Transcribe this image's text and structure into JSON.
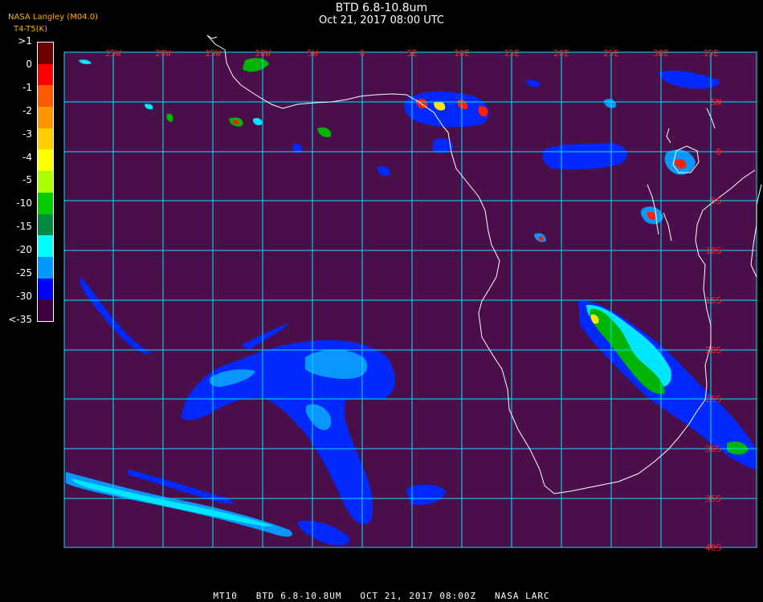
{
  "header": {
    "title": "BTD 6.8-10.8um",
    "subtitle": "Oct 21, 2017 08:00 UTC",
    "source_line1": "NASA Langley (M04.0)",
    "source_line2": "T4-T5(K)"
  },
  "legend": {
    "labels": [
      ">1",
      "0",
      "-1",
      "-2",
      "-3",
      "-4",
      "-5",
      "-10",
      "-15",
      "-20",
      "-25",
      "-30",
      "<-35"
    ],
    "colors": [
      "#6e0000",
      "#ff0000",
      "#ff5a00",
      "#ff9600",
      "#ffcd00",
      "#ffff00",
      "#aaff00",
      "#00cc00",
      "#008a40",
      "#00ffff",
      "#0096ff",
      "#0000ff",
      "#3c003c"
    ]
  },
  "map": {
    "background": "#4a0f4a",
    "grid_color": "#00e5ff",
    "coast_color": "#ffffff",
    "label_color": "#ff2020",
    "lon_labels": [
      "25W",
      "20W",
      "15W",
      "10W",
      "5W",
      "0",
      "5E",
      "10E",
      "15E",
      "20E",
      "25E",
      "30E",
      "35E"
    ],
    "lat_labels": [
      "5N",
      "0",
      "5S",
      "10S",
      "15S",
      "20S",
      "25S",
      "30S",
      "35S",
      "40S"
    ],
    "cloud_colors": {
      "blue": "#0028ff",
      "light_blue": "#0a96ff",
      "cyan": "#00e6ff",
      "green": "#00b400",
      "yellow": "#ffe600",
      "orange": "#ff8c00",
      "red": "#ff1e00",
      "dark_red": "#8c0000"
    }
  },
  "footer": {
    "text": "MT10   BTD 6.8-10.8UM   OCT 21, 2017 08:00Z   NASA LARC"
  }
}
